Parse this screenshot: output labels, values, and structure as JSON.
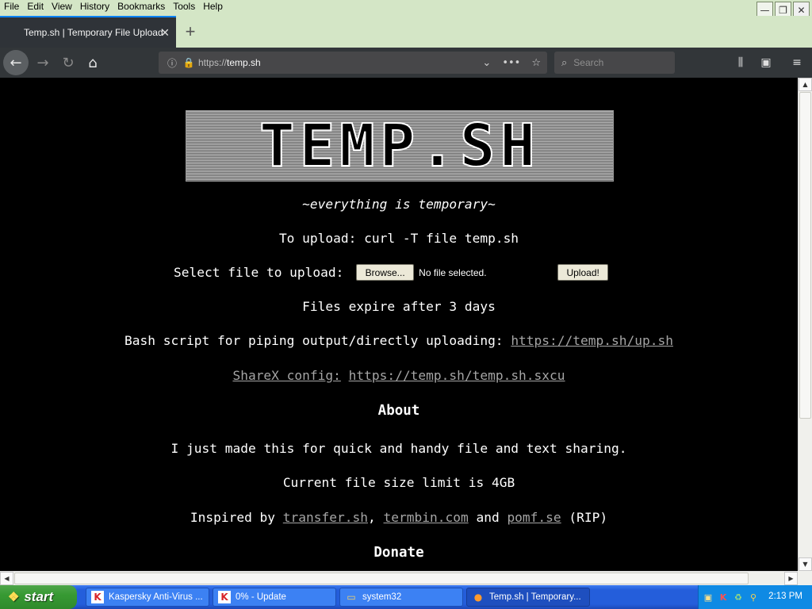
{
  "menubar": {
    "items": [
      "File",
      "Edit",
      "View",
      "History",
      "Bookmarks",
      "Tools",
      "Help"
    ]
  },
  "window_controls": {
    "minimize": "—",
    "maximize": "❐",
    "close": "✕"
  },
  "tab": {
    "title": "Temp.sh | Temporary File Upload",
    "close": "✕",
    "new_tab": "+"
  },
  "navbar": {
    "url_protocol": "https://",
    "url_host": "temp.sh",
    "search_placeholder": "Search",
    "icons": {
      "back": "←",
      "forward": "→",
      "reload": "↻",
      "home": "⌂",
      "info": "ⓘ",
      "lock": "🔒",
      "dropdown": "⌄",
      "page_actions": "•••",
      "bookmark": "☆",
      "search": "⌕",
      "library": "⫼",
      "sidebar": "▣",
      "menu": "≡"
    }
  },
  "page": {
    "logo_text": "TEMP.SH",
    "tagline": "~everything is temporary~",
    "upload_cmd": "To upload: curl -T file temp.sh",
    "select_label": "Select file to upload: ",
    "browse_button": "Browse...",
    "file_status": "No file selected.",
    "upload_button": "Upload!",
    "expire_text": "Files expire after 3 days",
    "bash_label": "Bash script for piping output/directly uploading: ",
    "bash_link": "https://temp.sh/up.sh",
    "sharex_label": "ShareX config:",
    "sharex_link": "https://temp.sh/temp.sh.sxcu",
    "about_heading": "About",
    "about_text": "I just made this for quick and handy file and text sharing.",
    "size_limit": "Current file size limit is 4GB",
    "inspired_prefix": "Inspired by ",
    "inspired_link1": "transfer.sh",
    "inspired_sep": ", ",
    "inspired_link2": "termbin.com",
    "inspired_and": " and ",
    "inspired_link3": "pomf.se",
    "inspired_suffix": " (RIP)",
    "donate_heading": "Donate"
  },
  "taskbar": {
    "start_label": "start",
    "tasks": [
      {
        "label": "Kaspersky Anti-Virus ...",
        "icon": "K"
      },
      {
        "label": "0% - Update",
        "icon": "K"
      },
      {
        "label": "system32",
        "icon": "▭"
      },
      {
        "label": "Temp.sh | Temporary...",
        "icon": "●"
      }
    ],
    "clock": "2:13 PM"
  },
  "colors": {
    "accent_tab": "#0a84ff",
    "link": "#a5a5a5",
    "lock_green": "#3fd13f",
    "taskbar_blue": "#245edb",
    "start_green": "#379a33"
  }
}
